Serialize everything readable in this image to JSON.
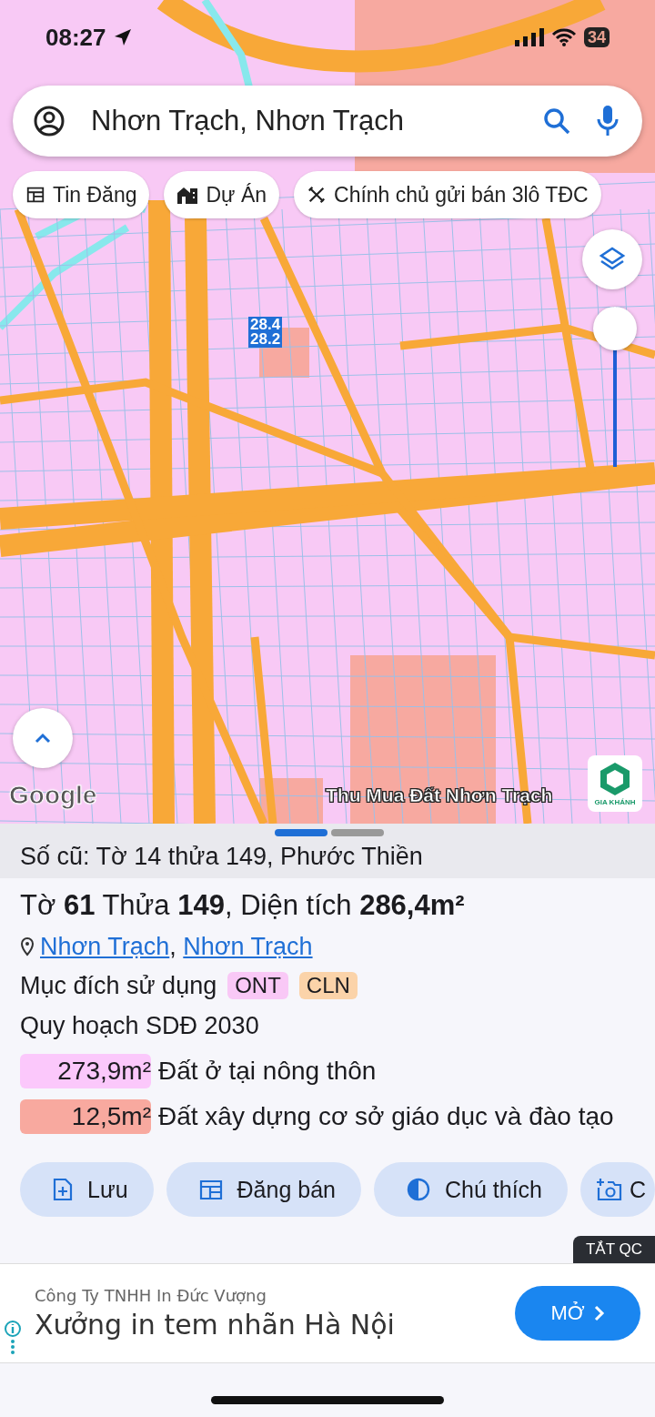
{
  "status_bar": {
    "time": "08:27",
    "battery": "34"
  },
  "search": {
    "value": "Nhơn Trạch, Nhơn Trạch"
  },
  "chips": [
    {
      "kind": "listing",
      "label": "Tin Đăng"
    },
    {
      "kind": "project",
      "label": "Dự Án"
    },
    {
      "kind": "tools",
      "label": "Chính chủ gửi bán 3lô TĐC"
    }
  ],
  "map": {
    "parcel_labels": [
      "28.4",
      "28.2"
    ],
    "attribution": "Google",
    "watermark_text": "Thu Mua Đất Nhơn Trạch",
    "logo_text": "GIA KHÁNH",
    "zoom_slider": {
      "level": 1
    }
  },
  "sheet": {
    "pages": [
      {
        "selected": true
      },
      {
        "selected": false
      }
    ],
    "old_number": "Số cũ: Tờ 14 thửa 149, Phước Thiền",
    "title": "Tờ **61** Thửa **149**, Diện tích **286,4m²**",
    "address": {
      "links": [
        "Nhơn Trạch",
        "Nhơn Trạch"
      ],
      "separator": ","
    },
    "purpose": {
      "label": "Mục đích sử dụng",
      "tags": [
        {
          "text": "ONT",
          "color": "#f9c8f6"
        },
        {
          "text": "CLN",
          "color": "#fbd3a9"
        }
      ]
    },
    "plan_title": "Quy hoạch SDĐ 2030",
    "plan_rows": [
      {
        "area": "273,9m²",
        "label": "Đất ở tại nông thôn",
        "color": "#fbc8fb"
      },
      {
        "area": "12,5m²",
        "label": "Đất xây dựng cơ sở giáo dục và đào tạo",
        "color": "#f8a99f"
      }
    ],
    "actions": [
      {
        "kind": "save",
        "label": "Lưu"
      },
      {
        "kind": "post",
        "label": "Đăng bán"
      },
      {
        "kind": "legend",
        "label": "Chú thích"
      },
      {
        "kind": "camera",
        "label": "C"
      }
    ]
  },
  "ad": {
    "close_label": "TẮT QC",
    "advertiser": "Công Ty TNHH In Đức Vượng",
    "headline": "Xưởng in tem nhãn Hà Nội",
    "button": "MỞ"
  }
}
